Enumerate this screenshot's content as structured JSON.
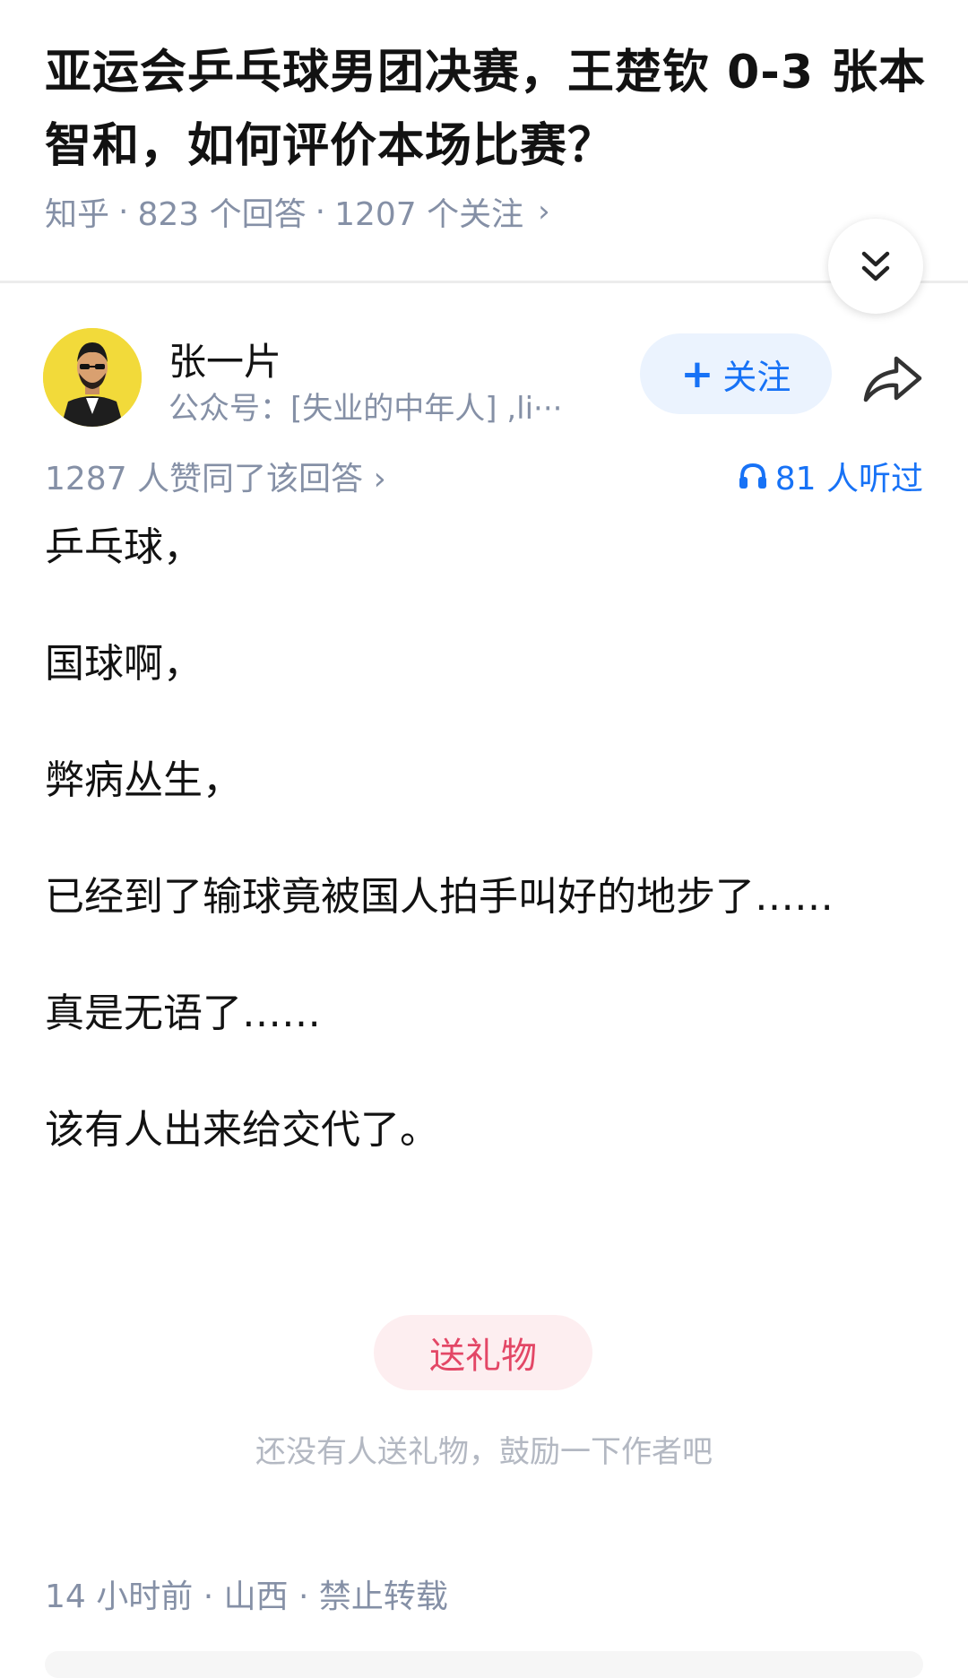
{
  "question": {
    "title": "亚运会乒乓球男团决赛，王楚钦 0-3 张本智和，如何评价本场比赛？",
    "source": "知乎",
    "answers": "823 个回答",
    "follows": "1207 个关注",
    "separator": "·",
    "chevron": "›"
  },
  "collapse": {
    "icon": "double-chevron-down-icon"
  },
  "author": {
    "name": "张一片",
    "bio": "公众号：[失业的中年人] ,li···",
    "follow_plus": "+",
    "follow_label": "关注",
    "share_icon": "share-icon"
  },
  "answer": {
    "votes": "1287 人赞同了该回答",
    "votes_chevron": "›",
    "listens": "81 人听过",
    "paragraphs": [
      "乒乓球，",
      "国球啊，",
      "弊病丛生，",
      "已经到了输球竟被国人拍手叫好的地步了……",
      "真是无语了……",
      "该有人出来给交代了。"
    ]
  },
  "gift": {
    "button_label": "送礼物",
    "hint": "还没有人送礼物，鼓励一下作者吧"
  },
  "footer": {
    "meta": "14 小时前 · 山西 · 禁止转载"
  },
  "colors": {
    "accent": "#1772f6",
    "gift": "#e34766",
    "meta_gray": "#8590a6"
  }
}
